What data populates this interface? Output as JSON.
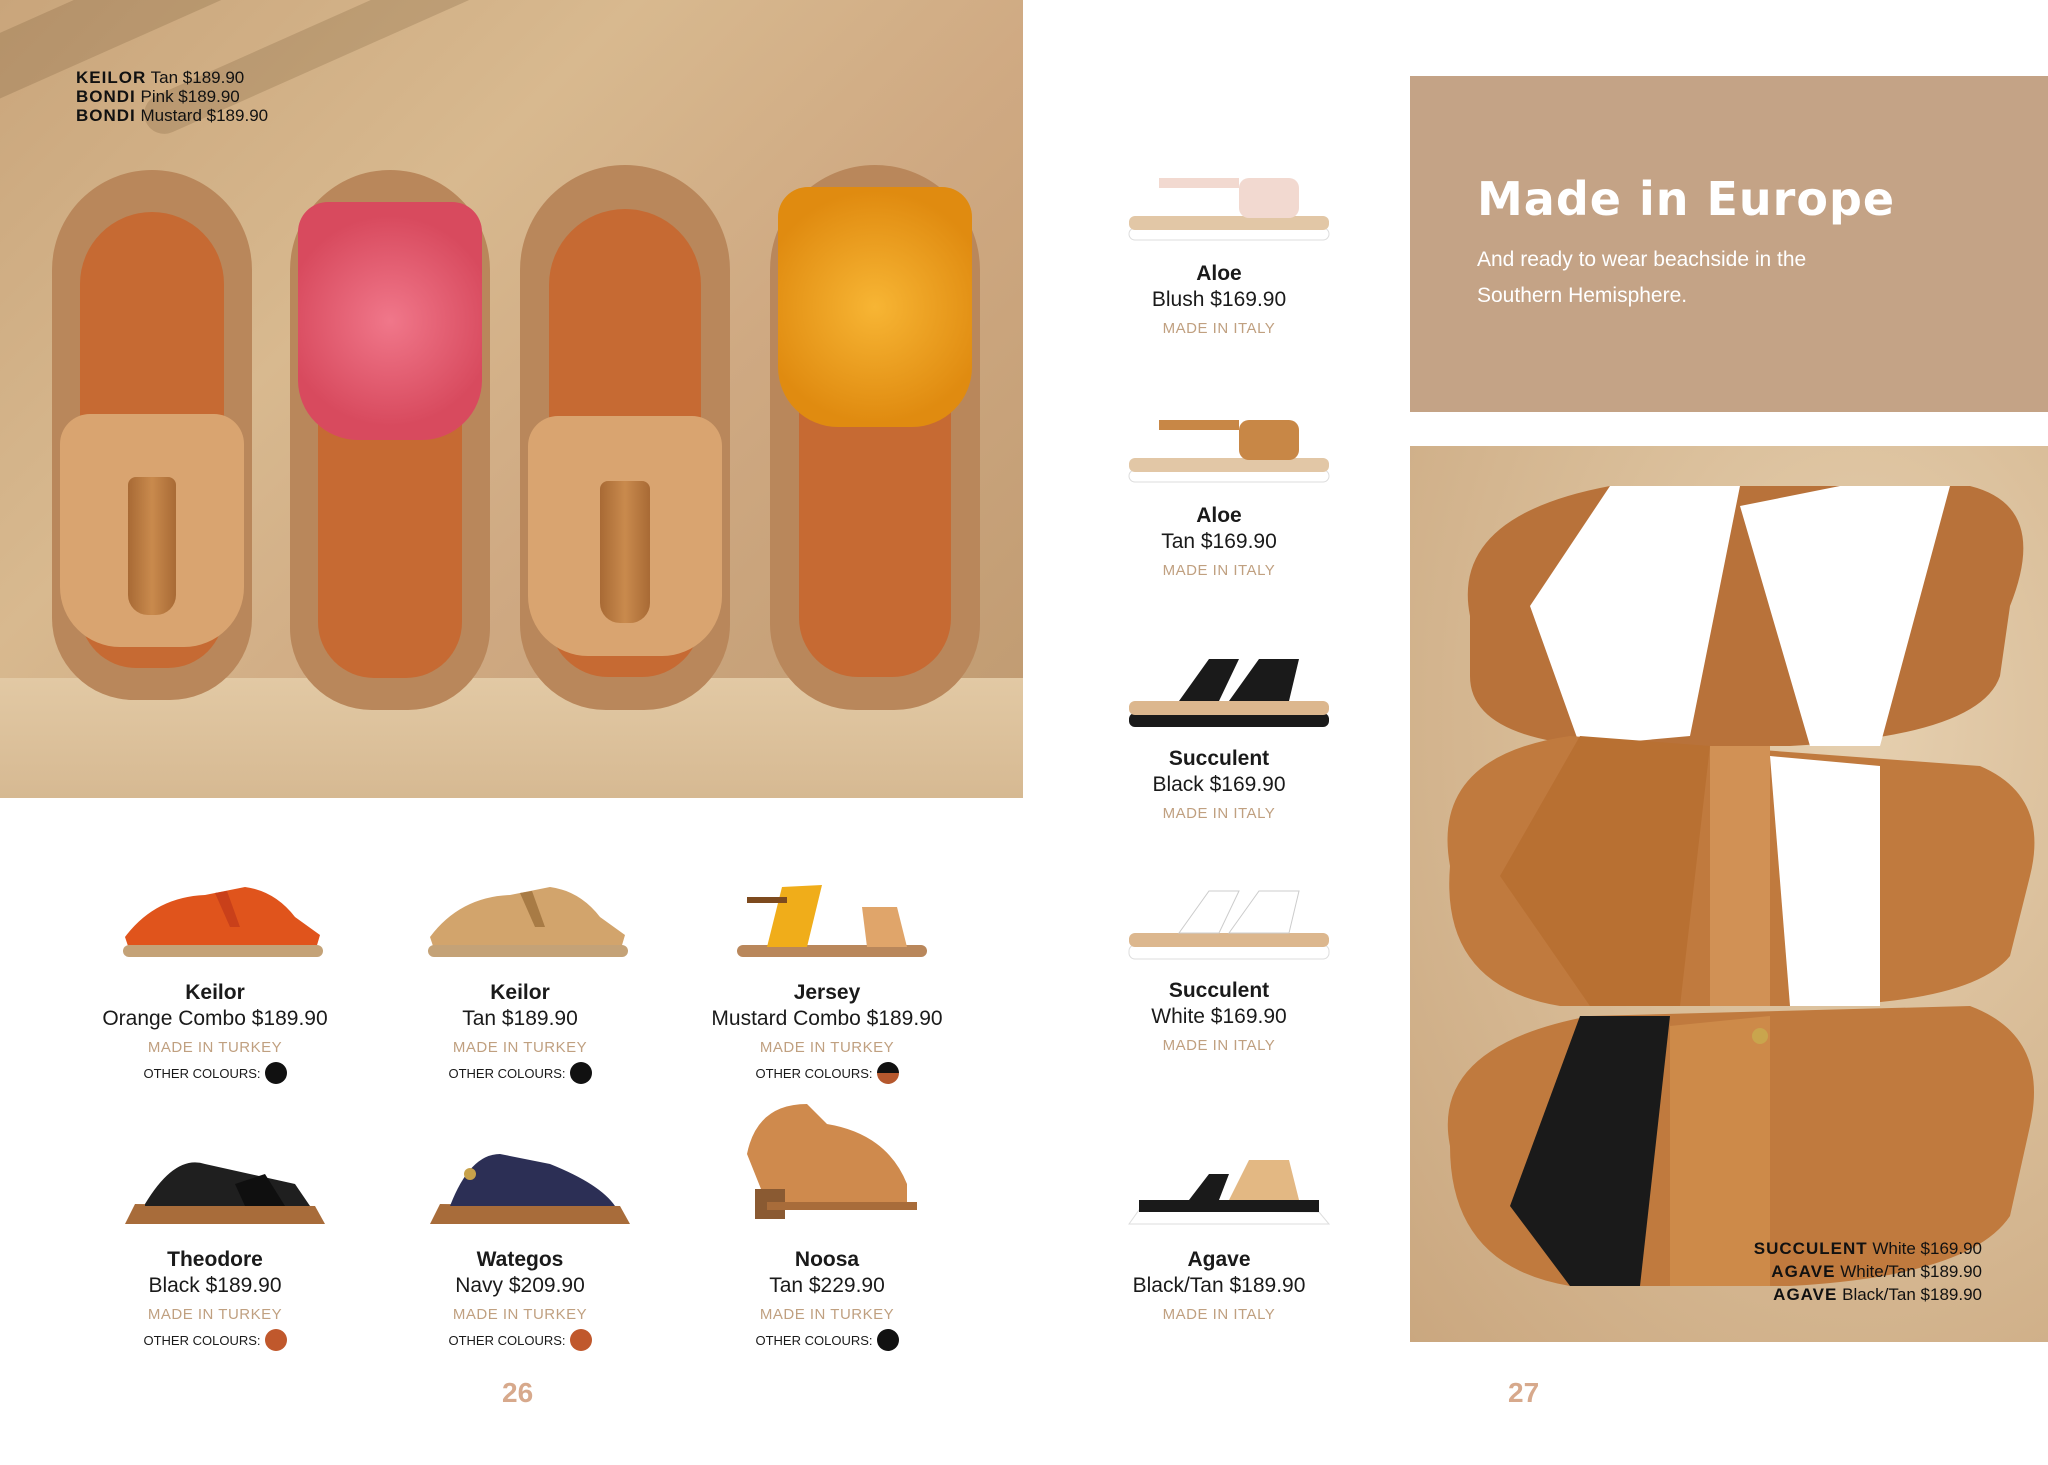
{
  "hero_left": {
    "captions": [
      {
        "name": "KEILOR",
        "detail": "Tan $189.90"
      },
      {
        "name": "BONDI",
        "detail": "Pink $189.90"
      },
      {
        "name": "BONDI",
        "detail": "Mustard $189.90"
      }
    ]
  },
  "products": [
    {
      "name": "Keilor",
      "price": "Orange Combo $189.90",
      "origin": "MADE IN TURKEY",
      "other_label": "OTHER COLOURS:",
      "dot_color": "#111111"
    },
    {
      "name": "Keilor",
      "price": "Tan $189.90",
      "origin": "MADE IN TURKEY",
      "other_label": "OTHER COLOURS:",
      "dot_color": "#111111"
    },
    {
      "name": "Jersey",
      "price": "Mustard Combo $189.90",
      "origin": "MADE IN TURKEY",
      "other_label": "OTHER COLOURS:",
      "dot_color": "#b5582e"
    },
    {
      "name": "Theodore",
      "price": "Black $189.90",
      "origin": "MADE IN TURKEY",
      "other_label": "OTHER COLOURS:",
      "dot_color": "#c0582c"
    },
    {
      "name": "Wategos",
      "price": "Navy $209.90",
      "origin": "MADE IN TURKEY",
      "other_label": "OTHER COLOURS:",
      "dot_color": "#c0582c"
    },
    {
      "name": "Noosa",
      "price": "Tan $229.90",
      "origin": "MADE IN TURKEY",
      "other_label": "OTHER COLOURS:",
      "dot_color": "#111111"
    },
    {
      "name": "Aloe",
      "price": "Blush $169.90",
      "origin": "MADE IN ITALY"
    },
    {
      "name": "Aloe",
      "price": "Tan $169.90",
      "origin": "MADE IN ITALY"
    },
    {
      "name": "Succulent",
      "price": "Black $169.90",
      "origin": "MADE IN ITALY"
    },
    {
      "name": "Succulent",
      "price": "White $169.90",
      "origin": "MADE IN ITALY"
    },
    {
      "name": "Agave",
      "price": "Black/Tan $189.90",
      "origin": "MADE IN ITALY"
    }
  ],
  "page_numbers": {
    "left": "26",
    "right": "27"
  },
  "banner": {
    "title": "Made in Europe",
    "subtitle": "And ready to wear beachside in the Southern Hemisphere."
  },
  "hero_right": {
    "captions": [
      {
        "name": "SUCCULENT",
        "detail": "White $169.90"
      },
      {
        "name": "AGAVE",
        "detail": "White/Tan $189.90"
      },
      {
        "name": "AGAVE",
        "detail": "Black/Tan $189.90"
      }
    ]
  },
  "colors": {
    "banner_bg": "#c4a386",
    "origin_text": "#c0a080",
    "page_number": "#d7a98c"
  }
}
